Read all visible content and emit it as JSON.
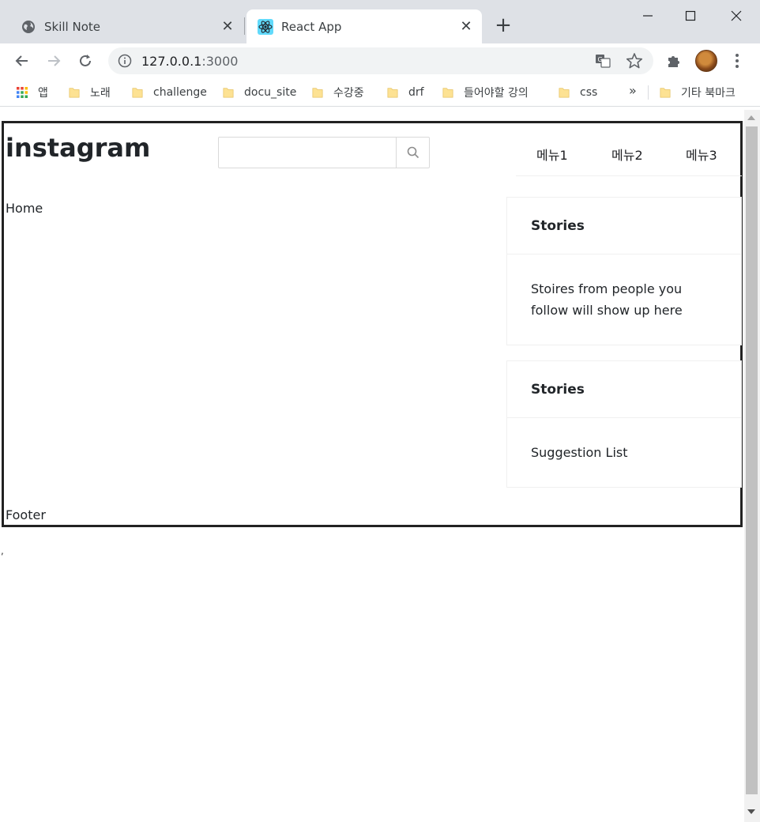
{
  "browser": {
    "tabs": [
      {
        "title": "Skill Note",
        "icon": "globe-icon",
        "active": false
      },
      {
        "title": "React App",
        "icon": "react-icon",
        "active": true
      }
    ],
    "close_glyph": "✕",
    "new_tab_glyph": "+",
    "url_host": "127.0.0.1",
    "url_port": ":3000",
    "bookmarks": [
      {
        "label": "앱",
        "icon": "apps-grid-icon"
      },
      {
        "label": "노래",
        "icon": "folder-icon"
      },
      {
        "label": "challenge",
        "icon": "folder-icon"
      },
      {
        "label": "docu_site",
        "icon": "folder-icon"
      },
      {
        "label": "수강중",
        "icon": "folder-icon"
      },
      {
        "label": "drf",
        "icon": "folder-icon"
      },
      {
        "label": "들어야할 강의",
        "icon": "folder-icon"
      },
      {
        "label": "css",
        "icon": "folder-icon"
      }
    ],
    "more_bookmarks": "»",
    "other_bookmarks": "기타 북마크"
  },
  "app": {
    "logo": "instagram",
    "search": {
      "placeholder": "",
      "value": ""
    },
    "menu": [
      "메뉴1",
      "메뉴2",
      "메뉴3"
    ],
    "home": "Home",
    "cards": [
      {
        "title": "Stories",
        "body": "Stoires from people you follow will show up here"
      },
      {
        "title": "Stories",
        "body": "Suggestion List"
      }
    ],
    "footer": "Footer",
    "stray_text": ","
  },
  "colors": {
    "tabstrip": "#dee1e6",
    "omnibox": "#f1f3f4",
    "frame_border": "#222222",
    "card_border": "#f0f0f0",
    "folder": "#fde293"
  }
}
